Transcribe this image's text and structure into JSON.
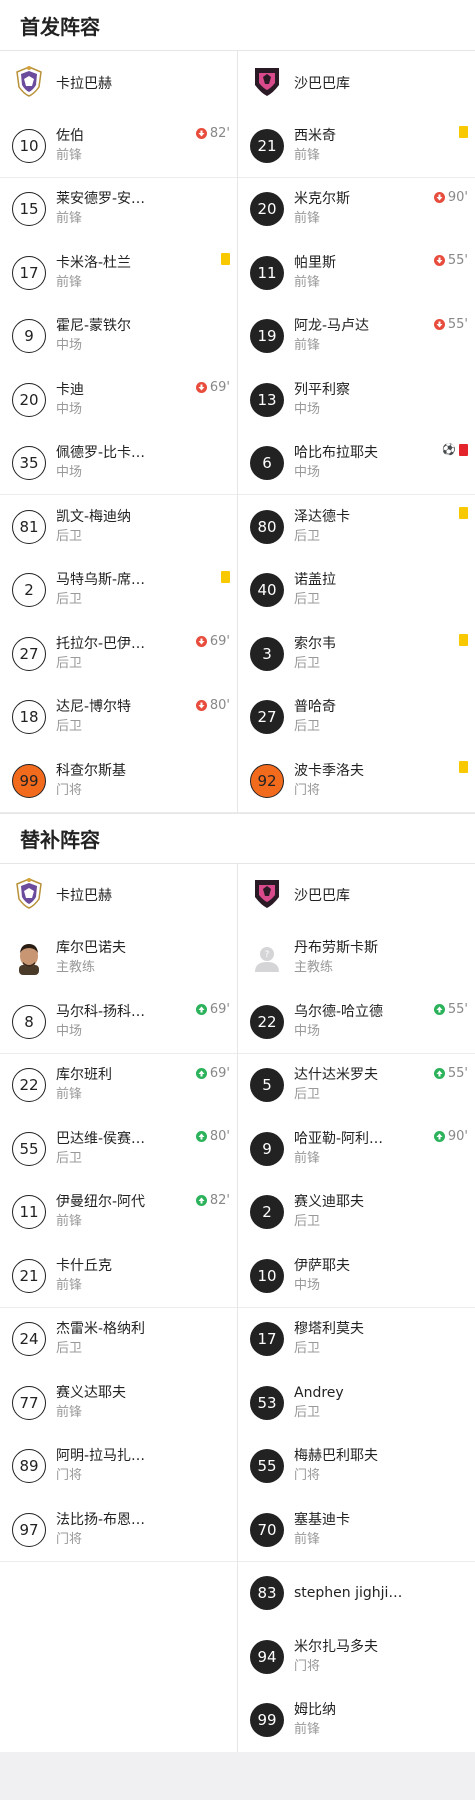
{
  "starting": {
    "title": "首发阵容",
    "home": {
      "team": "卡拉巴赫",
      "players": [
        {
          "num": "10",
          "name": "佐伯",
          "pos": "前锋",
          "style": "white",
          "events": [
            {
              "type": "out",
              "minute": "82'"
            }
          ]
        },
        {
          "num": "15",
          "name": "莱安德罗-安…",
          "pos": "前锋",
          "style": "white",
          "events": []
        },
        {
          "num": "17",
          "name": "卡米洛-杜兰",
          "pos": "前锋",
          "style": "white",
          "events": [
            {
              "type": "yellow"
            }
          ]
        },
        {
          "num": "9",
          "name": "霍尼-蒙铁尔",
          "pos": "中场",
          "style": "white",
          "events": []
        },
        {
          "num": "20",
          "name": "卡迪",
          "pos": "中场",
          "style": "white",
          "events": [
            {
              "type": "out",
              "minute": "69'"
            }
          ]
        },
        {
          "num": "35",
          "name": "佩德罗-比卡…",
          "pos": "中场",
          "style": "white",
          "events": []
        },
        {
          "num": "81",
          "name": "凯文-梅迪纳",
          "pos": "后卫",
          "style": "white",
          "events": []
        },
        {
          "num": "2",
          "name": "马特乌斯-席…",
          "pos": "后卫",
          "style": "white",
          "events": [
            {
              "type": "yellow"
            }
          ]
        },
        {
          "num": "27",
          "name": "托拉尔-巴伊…",
          "pos": "后卫",
          "style": "white",
          "events": [
            {
              "type": "out",
              "minute": "69'"
            }
          ]
        },
        {
          "num": "18",
          "name": "达尼-博尔特",
          "pos": "后卫",
          "style": "white",
          "events": [
            {
              "type": "out",
              "minute": "80'"
            }
          ]
        },
        {
          "num": "99",
          "name": "科查尔斯基",
          "pos": "门将",
          "style": "orange",
          "events": []
        }
      ]
    },
    "away": {
      "team": "沙巴巴库",
      "players": [
        {
          "num": "21",
          "name": "西米奇",
          "pos": "前锋",
          "style": "black",
          "events": [
            {
              "type": "yellow"
            }
          ]
        },
        {
          "num": "20",
          "name": "米克尔斯",
          "pos": "前锋",
          "style": "black",
          "events": [
            {
              "type": "out",
              "minute": "90'"
            }
          ]
        },
        {
          "num": "11",
          "name": "帕里斯",
          "pos": "前锋",
          "style": "black",
          "events": [
            {
              "type": "out",
              "minute": "55'"
            }
          ]
        },
        {
          "num": "19",
          "name": "阿龙-马卢达",
          "pos": "前锋",
          "style": "black",
          "events": [
            {
              "type": "out",
              "minute": "55'"
            }
          ]
        },
        {
          "num": "13",
          "name": "列平利察",
          "pos": "中场",
          "style": "black",
          "events": []
        },
        {
          "num": "6",
          "name": "哈比布拉耶夫",
          "pos": "中场",
          "style": "black",
          "events": [
            {
              "type": "ball"
            },
            {
              "type": "red"
            }
          ]
        },
        {
          "num": "80",
          "name": "泽达德卡",
          "pos": "后卫",
          "style": "black",
          "events": [
            {
              "type": "yellow"
            }
          ]
        },
        {
          "num": "40",
          "name": "诺盖拉",
          "pos": "后卫",
          "style": "black",
          "events": []
        },
        {
          "num": "3",
          "name": "索尔韦",
          "pos": "后卫",
          "style": "black",
          "events": [
            {
              "type": "yellow"
            }
          ]
        },
        {
          "num": "27",
          "name": "普哈奇",
          "pos": "后卫",
          "style": "black",
          "events": []
        },
        {
          "num": "92",
          "name": "波卡季洛夫",
          "pos": "门将",
          "style": "orange",
          "events": [
            {
              "type": "yellow"
            }
          ]
        }
      ]
    }
  },
  "subs": {
    "title": "替补阵容",
    "home": {
      "team": "卡拉巴赫",
      "coach": {
        "name": "库尔巴诺夫",
        "role": "主教练"
      },
      "players": [
        {
          "num": "8",
          "name": "马尔科-扬科…",
          "pos": "中场",
          "style": "white",
          "events": [
            {
              "type": "in",
              "minute": "69'"
            }
          ]
        },
        {
          "num": "22",
          "name": "库尔班利",
          "pos": "前锋",
          "style": "white",
          "events": [
            {
              "type": "in",
              "minute": "69'"
            }
          ]
        },
        {
          "num": "55",
          "name": "巴达维-侯赛…",
          "pos": "后卫",
          "style": "white",
          "events": [
            {
              "type": "in",
              "minute": "80'"
            }
          ]
        },
        {
          "num": "11",
          "name": "伊曼纽尔-阿代",
          "pos": "前锋",
          "style": "white",
          "events": [
            {
              "type": "in",
              "minute": "82'"
            }
          ]
        },
        {
          "num": "21",
          "name": "卡什丘克",
          "pos": "前锋",
          "style": "white",
          "events": []
        },
        {
          "num": "24",
          "name": "杰雷米-格纳利",
          "pos": "后卫",
          "style": "white",
          "events": []
        },
        {
          "num": "77",
          "name": "赛义达耶夫",
          "pos": "前锋",
          "style": "white",
          "events": []
        },
        {
          "num": "89",
          "name": "阿明-拉马扎…",
          "pos": "门将",
          "style": "white",
          "events": []
        },
        {
          "num": "97",
          "name": "法比扬-布恩…",
          "pos": "门将",
          "style": "white",
          "events": []
        }
      ]
    },
    "away": {
      "team": "沙巴巴库",
      "coach": {
        "name": "丹布劳斯卡斯",
        "role": "主教练"
      },
      "players": [
        {
          "num": "22",
          "name": "乌尔德-哈立德",
          "pos": "中场",
          "style": "black",
          "events": [
            {
              "type": "in",
              "minute": "55'"
            }
          ]
        },
        {
          "num": "5",
          "name": "达什达米罗夫",
          "pos": "后卫",
          "style": "black",
          "events": [
            {
              "type": "in",
              "minute": "55'"
            }
          ]
        },
        {
          "num": "9",
          "name": "哈亚勒-阿利…",
          "pos": "前锋",
          "style": "black",
          "events": [
            {
              "type": "in",
              "minute": "90'"
            }
          ]
        },
        {
          "num": "2",
          "name": "赛义迪耶夫",
          "pos": "后卫",
          "style": "black",
          "events": []
        },
        {
          "num": "10",
          "name": "伊萨耶夫",
          "pos": "中场",
          "style": "black",
          "events": []
        },
        {
          "num": "17",
          "name": "穆塔利莫夫",
          "pos": "后卫",
          "style": "black",
          "events": []
        },
        {
          "num": "53",
          "name": "Andrey",
          "pos": "后卫",
          "style": "black",
          "events": []
        },
        {
          "num": "55",
          "name": "梅赫巴利耶夫",
          "pos": "门将",
          "style": "black",
          "events": []
        },
        {
          "num": "70",
          "name": "塞基迪卡",
          "pos": "前锋",
          "style": "black",
          "events": []
        },
        {
          "num": "83",
          "name": "stephen jighji…",
          "pos": "",
          "style": "black",
          "events": []
        },
        {
          "num": "94",
          "name": "米尔扎马多夫",
          "pos": "门将",
          "style": "black",
          "events": []
        },
        {
          "num": "99",
          "name": "姆比纳",
          "pos": "前锋",
          "style": "black",
          "events": []
        }
      ]
    }
  },
  "colors": {
    "yellow_card": "#f8c800",
    "red_card": "#e3252b",
    "sub_out": "#e74c3c",
    "sub_in": "#2bb25b",
    "goalkeeper": "#f26b1d"
  }
}
